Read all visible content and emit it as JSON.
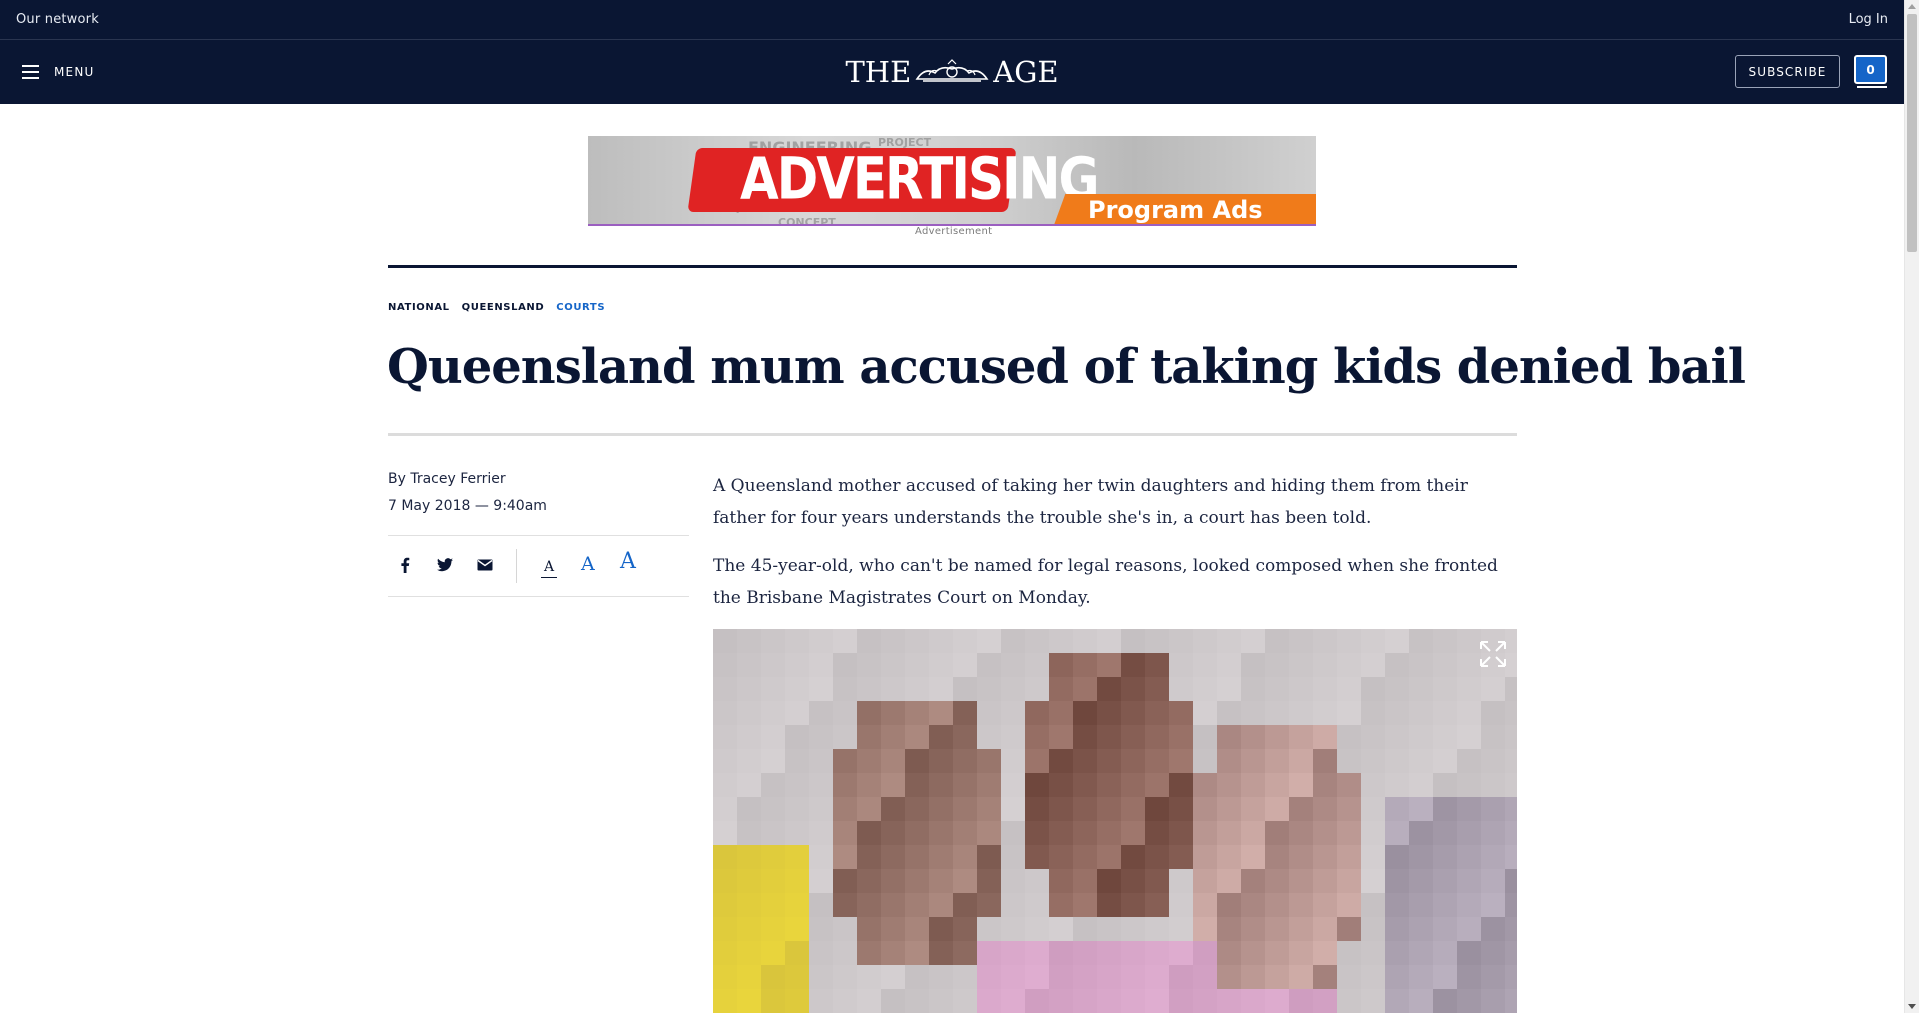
{
  "topbar": {
    "network_label": "Our network",
    "login_label": "Log In"
  },
  "nav": {
    "menu_label": "MENU",
    "logo_left": "THE",
    "logo_right": "AGE",
    "subscribe_label": "SUBSCRIBE",
    "notification_count": "0"
  },
  "ad": {
    "headline": "ADVERTISING",
    "tagline": "Program Ads",
    "background_words": [
      "ENGINEERING",
      "PROJECT",
      "CONCEPT",
      "PROJECT"
    ],
    "label": "Advertisement"
  },
  "article": {
    "breadcrumbs": [
      {
        "label": "NATIONAL",
        "active": false
      },
      {
        "label": "QUEENSLAND",
        "active": false
      },
      {
        "label": "COURTS",
        "active": true
      }
    ],
    "headline": "Queensland mum accused of taking kids denied bail",
    "byline": "By Tracey Ferrier",
    "date": "7 May 2018 — 9:40am",
    "paragraphs": [
      "A Queensland mother accused of taking her twin daughters and hiding them from their father for four years understands the trouble she's in, a court has been told.",
      "The 45-year-old, who can't be named for legal reasons, looked composed when she fronted the Brisbane Magistrates Court on Monday."
    ],
    "share_icons": [
      "facebook-icon",
      "twitter-icon",
      "email-icon"
    ],
    "font_size_controls": [
      "A",
      "A",
      "A"
    ]
  },
  "colors": {
    "navy": "#0a1633",
    "accent_blue": "#1565c8",
    "ad_red": "#e02323",
    "ad_orange": "#f07b1a"
  }
}
